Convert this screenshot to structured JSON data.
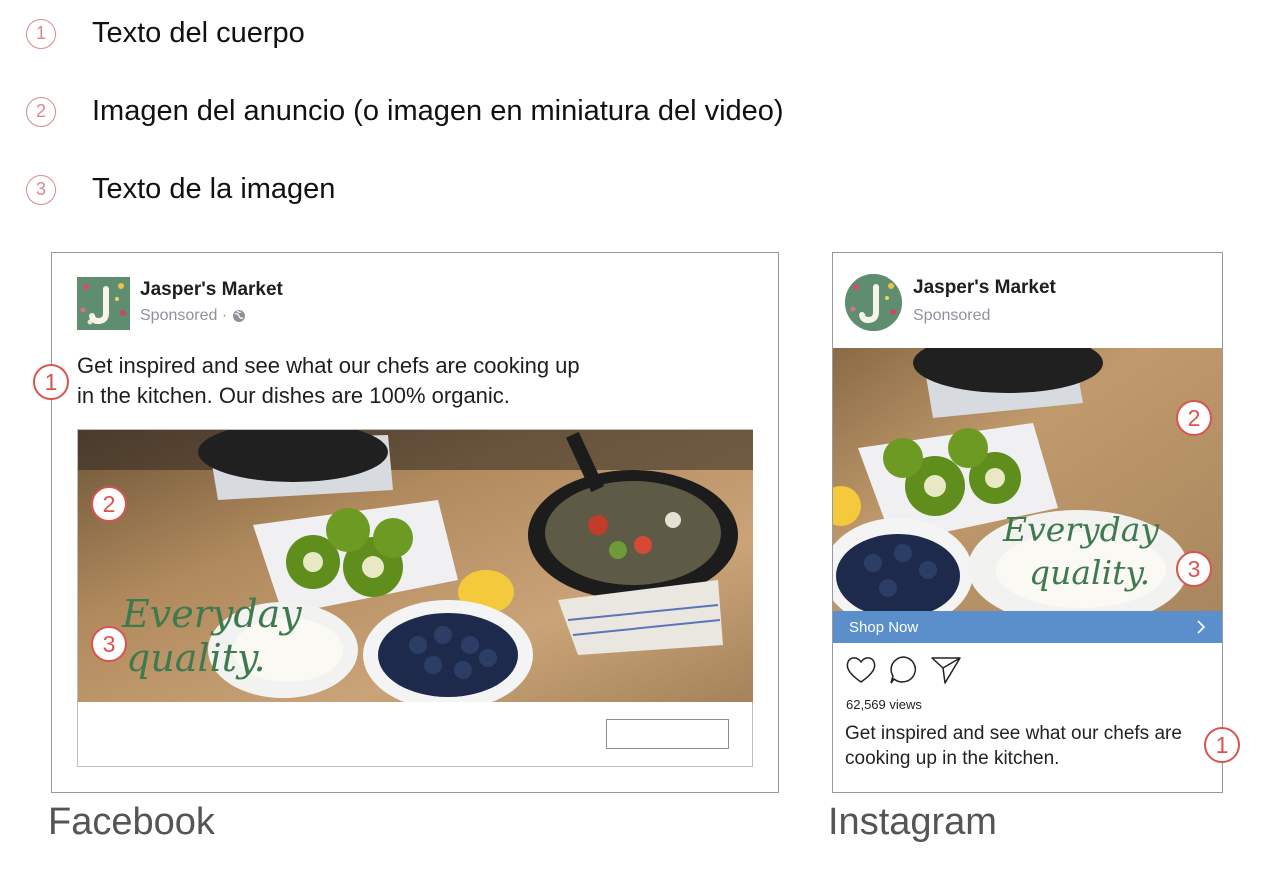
{
  "legend": [
    {
      "num": "1",
      "text": "Texto del cuerpo"
    },
    {
      "num": "2",
      "text": "Imagen del anuncio (o imagen en miniatura del video)"
    },
    {
      "num": "3",
      "text": "Texto de la imagen"
    }
  ],
  "facebook": {
    "caption": "Facebook",
    "page_name": "Jasper's Market",
    "sponsored": "Sponsored ·",
    "body_line1": "Get inspired and see what our chefs are cooking up",
    "body_line2": "in the kitchen. Our dishes are 100% organic.",
    "overlay_line1": "Everyday",
    "overlay_line2": "quality.",
    "callouts": [
      "1",
      "2",
      "3"
    ]
  },
  "instagram": {
    "caption": "Instagram",
    "page_name": "Jasper's Market",
    "sponsored": "Sponsored",
    "overlay_line1": "Everyday",
    "overlay_line2": "quality.",
    "cta_label": "Shop Now",
    "views": "62,569 views",
    "body_line1": "Get inspired and see what our chefs are",
    "body_line2": "cooking up in the kitchen.",
    "callouts": [
      "2",
      "3",
      "1"
    ]
  },
  "colors": {
    "callout": "#d9534f",
    "legend_number": "#d88a8a",
    "cta": "#5b8fcc",
    "overlay_text": "#3f7a4f"
  },
  "icons": [
    "globe-icon",
    "heart-icon",
    "comment-icon",
    "send-icon",
    "chevron-right-icon"
  ]
}
